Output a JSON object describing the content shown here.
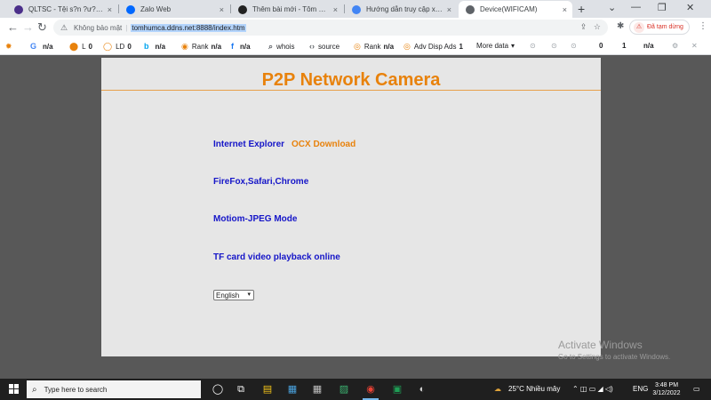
{
  "browser": {
    "tabs": [
      {
        "label": "QLTSC - Tệi s?n ?ư?ng b7",
        "color": "#4b2f8a"
      },
      {
        "label": "Zalo Web",
        "color": "#0068ff"
      },
      {
        "label": "Thêm bài mới - Tôm hùm Mi",
        "color": "#222222"
      },
      {
        "label": "Hướng dẫn truy cập xem tru",
        "color": "#4285f4"
      },
      {
        "label": "Device(WIFICAM)",
        "color": "#5f6368"
      }
    ],
    "close_glyph": "×",
    "new_tab": "+",
    "window_controls": [
      "⌄",
      "—",
      "❐",
      "✕"
    ],
    "nav": {
      "back": "←",
      "forward": "→",
      "reload": "↻"
    },
    "address": {
      "not_secure": "Không bảo mật",
      "separator": "|",
      "url": "tomhumca.ddns.net:8888/index.htm"
    },
    "profile_label": "Đã tạm dừng",
    "profile_avatar": "⚠",
    "menu_glyph": "⋮"
  },
  "extensions": [
    {
      "icon": "✹",
      "label": "",
      "value": ""
    },
    {
      "icon": "G",
      "label": "",
      "value": "n/a",
      "color": "#4285f4"
    },
    {
      "icon": "⬤",
      "label": "L",
      "value": "0",
      "color": "#e8820c"
    },
    {
      "icon": "◯",
      "label": "LD",
      "value": "0",
      "color": "#e8820c"
    },
    {
      "icon": "b",
      "label": "",
      "value": "n/a",
      "color": "#00a4ef"
    },
    {
      "icon": "◉",
      "label": "Rank",
      "value": "n/a",
      "color": "#e8820c"
    },
    {
      "icon": "f",
      "label": "",
      "value": "n/a",
      "color": "#1877f2"
    },
    {
      "icon": "⌕",
      "label": "whois",
      "value": "",
      "color": "#5f6368"
    },
    {
      "icon": "‹›",
      "label": "source",
      "value": "",
      "color": "#5f6368"
    },
    {
      "icon": "◎",
      "label": "Rank",
      "value": "n/a",
      "color": "#e8820c"
    },
    {
      "icon": "◎",
      "label": "Adv Disp Ads",
      "value": "1",
      "color": "#e8820c"
    },
    {
      "icon": "",
      "label": "More data",
      "value": "▾",
      "color": "#5f6368"
    }
  ],
  "ext_right": [
    "⊙",
    "⊙",
    "⊙",
    "0",
    "1",
    "n/a",
    "⚙",
    "✕"
  ],
  "page": {
    "title": "P2P Network Camera",
    "links": {
      "ie": "Internet Explorer",
      "ocx": "OCX Download",
      "firefox": "FireFox,Safari,Chrome",
      "mjpeg": "Motiom-JPEG Mode",
      "tfcard": "TF card video playback online"
    },
    "language": {
      "selected": "English",
      "arrow": "▾"
    }
  },
  "watermark": {
    "line1": "Activate Windows",
    "line2": "Go to Settings to activate Windows."
  },
  "taskbar": {
    "search_placeholder": "Type here to search",
    "search_icon": "⌕",
    "apps": [
      "◯",
      "⧉",
      "▤",
      "▦",
      "▦",
      "▨",
      "◉",
      "▣",
      "◐"
    ],
    "weather": "25°C  Nhiều mây",
    "tray_icons": "⌃ ◫ ▭ ◢ ◁)",
    "lang": "ENG",
    "time": "3:48 PM",
    "date": "3/12/2022"
  }
}
